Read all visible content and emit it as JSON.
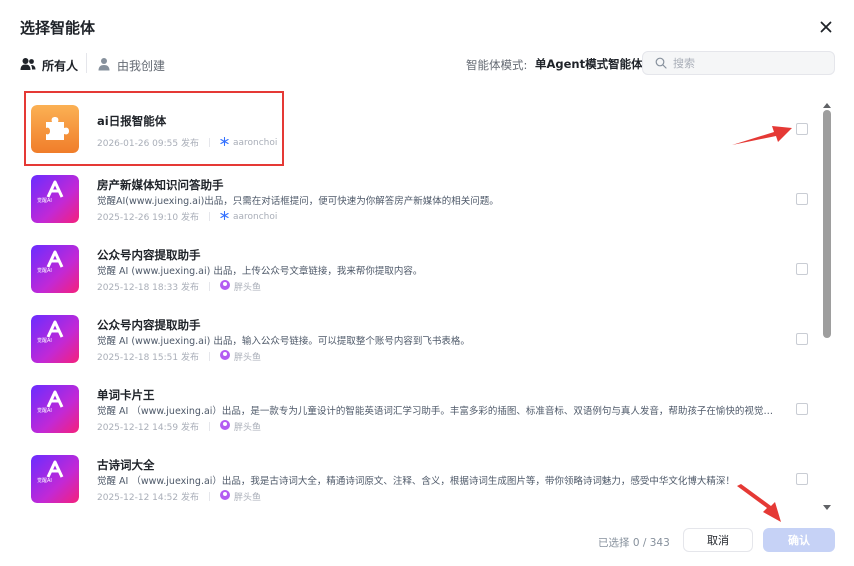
{
  "dialog": {
    "title": "选择智能体"
  },
  "tabs": [
    {
      "label": "所有人",
      "icon": "users-icon",
      "active": true
    },
    {
      "label": "由我创建",
      "icon": "user-icon",
      "active": false
    }
  ],
  "mode": {
    "label": "智能体模式:",
    "value": "单Agent模式智能体"
  },
  "search": {
    "placeholder": "搜索",
    "value": ""
  },
  "items": [
    {
      "name": "ai日报智能体",
      "desc": "",
      "date": "2026-01-26 09:55 发布",
      "creator": "aaronchoi",
      "creator_icon": "snowflake-icon",
      "avatar": "puzzle-icon",
      "checked": false
    },
    {
      "name": "房产新媒体知识问答助手",
      "desc": "觉醒AI(www.juexing.ai)出品，只需在对话框提问，便可快速为你解答房产新媒体的相关问题。",
      "date": "2025-12-26 19:10 发布",
      "creator": "aaronchoi",
      "creator_icon": "snowflake-icon",
      "avatar": "juexing-logo",
      "checked": false
    },
    {
      "name": "公众号内容提取助手",
      "desc": "觉醒 AI (www.juexing.ai) 出品，上传公众号文章链接，我来帮你提取内容。",
      "date": "2025-12-18 18:33 发布",
      "creator": "胖头鱼",
      "creator_icon": "avatar-icon",
      "avatar": "juexing-logo",
      "checked": false
    },
    {
      "name": "公众号内容提取助手",
      "desc": "觉醒 AI (www.juexing.ai) 出品，输入公众号链接。可以提取整个账号内容到飞书表格。",
      "date": "2025-12-18 15:51 发布",
      "creator": "胖头鱼",
      "creator_icon": "avatar-icon",
      "avatar": "juexing-logo",
      "checked": false
    },
    {
      "name": "单词卡片王",
      "desc": "觉醒 AI （www.juexing.ai）出品，是一款专为儿童设计的智能英语词汇学习助手。丰富多彩的插图、标准音标、双语例句与真人发音，帮助孩子在愉快的视觉体验中高效...",
      "date": "2025-12-12 14:59 发布",
      "creator": "胖头鱼",
      "creator_icon": "avatar-icon",
      "avatar": "juexing-logo",
      "checked": false
    },
    {
      "name": "古诗词大全",
      "desc": "觉醒 AI （www.juexing.ai）出品，我是古诗词大全，精通诗词原文、注释、含义，根据诗词生成图片等，带你领略诗词魅力，感受中华文化博大精深！",
      "date": "2025-12-12 14:52 发布",
      "creator": "胖头鱼",
      "creator_icon": "avatar-icon",
      "avatar": "juexing-logo",
      "checked": false
    }
  ],
  "avatar_label": "觉醒AI",
  "footer": {
    "selected": "已选择 0 / 343",
    "cancel": "取消",
    "confirm": "确认"
  },
  "colors": {
    "accent": "#3370ff",
    "confirm_disabled": "#c6d2f6",
    "annotation": "#e53935",
    "puzzle_bg": "#f79a3a"
  }
}
